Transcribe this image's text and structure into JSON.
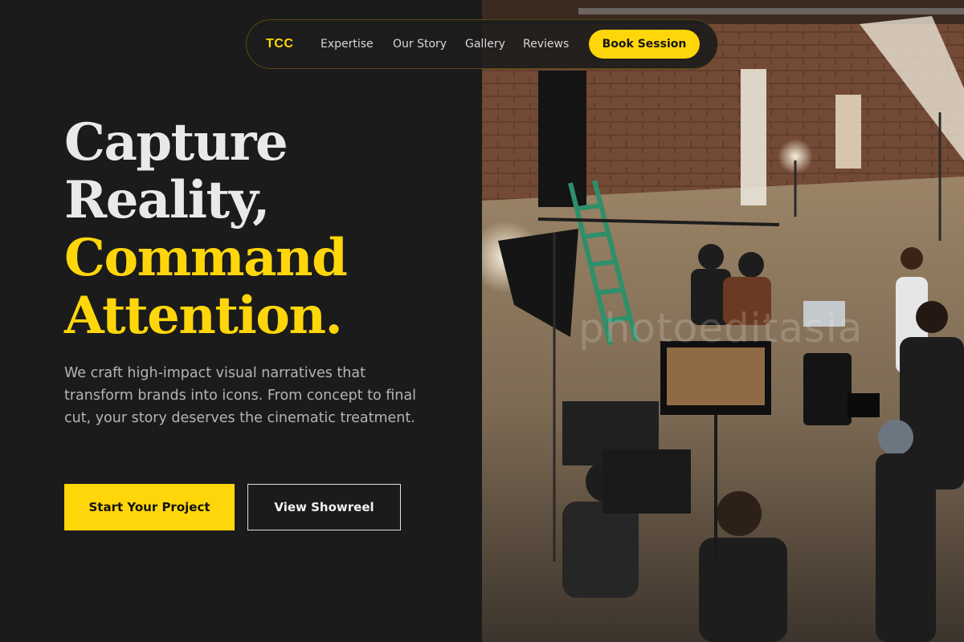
{
  "nav": {
    "logo": "TCC",
    "links": [
      "Expertise",
      "Our Story",
      "Gallery",
      "Reviews"
    ],
    "cta": "Book Session"
  },
  "hero": {
    "headline_light": [
      "Capture",
      "Reality,"
    ],
    "headline_accent": [
      "Command",
      "Attention."
    ],
    "subcopy": "We craft high-impact visual narratives that transform brands into icons. From concept to final cut, your story deserves the cinematic treatment.",
    "primary_button": "Start Your Project",
    "secondary_button": "View Showreel"
  },
  "photo": {
    "watermark": "photoeditasia"
  },
  "colors": {
    "accent": "#ffd60a",
    "background": "#1b1b1b",
    "text_light": "#e9e9e9",
    "text_muted": "#b4b4b4"
  }
}
